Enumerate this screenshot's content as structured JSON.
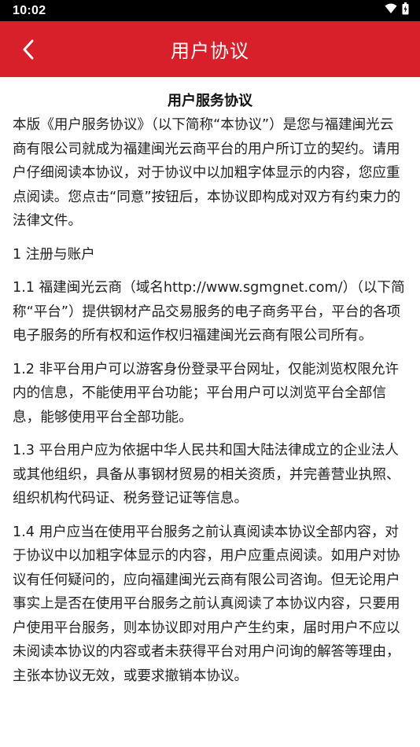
{
  "status_bar": {
    "time": "10:02",
    "icons": [
      "wifi-icon",
      "battery-icon"
    ]
  },
  "header": {
    "title": "用户协议",
    "back_icon": "chevron-left-icon",
    "color": "#d7202a"
  },
  "document": {
    "title": "用户服务协议",
    "paragraphs": [
      "本版《用户服务协议》（以下简称“本协议”）是您与福建闽光云商有限公司就成为福建闽光云商平台的用户所订立的契约。请用户仔细阅读本协议，对于协议中以加粗字体显示的内容，您应重点阅读。您点击“同意”按钮后，本协议即构成对双方有约束力的法律文件。",
      "1 注册与账户",
      "1.1 福建闽光云商（域名http://www.sgmgnet.com/）（以下简称“平台”）提供钢材产品交易服务的电子商务平台，平台的各项电子服务的所有权和运作权归福建闽光云商有限公司所有。",
      "1.2 非平台用户可以游客身份登录平台网址，仅能浏览权限允许内的信息，不能使用平台功能；平台用户可以浏览平台全部信息，能够使用平台全部功能。",
      "1.3 平台用户应为依据中华人民共和国大陆法律成立的企业法人或其他组织，具备从事钢材贸易的相关资质，并完善营业执照、组织机构代码证、税务登记证等信息。",
      "1.4 用户应当在使用平台服务之前认真阅读本协议全部内容，对于协议中以加粗字体显示的内容，用户应重点阅读。如用户对协议有任何疑问的，应向福建闽光云商有限公司咨询。但无论用户事实上是否在使用平台服务之前认真阅读了本协议内容，只要用户使用平台服务，则本协议即对用户产生约束，届时用户不应以未阅读本协议的内容或者未获得平台对用户问询的解答等理由，主张本协议无效，或要求撤销本协议。"
    ]
  }
}
